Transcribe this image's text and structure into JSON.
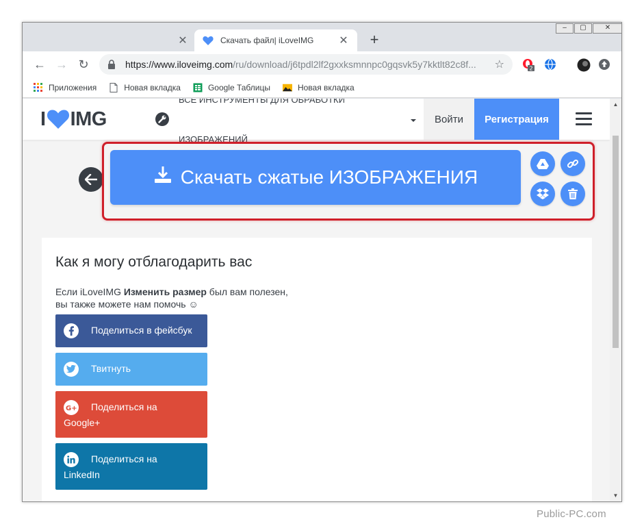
{
  "browser": {
    "tabs": [
      {
        "title": "",
        "active": false
      },
      {
        "title": "Скачать файл| iLoveIMG",
        "active": true
      }
    ],
    "url_host": "https://www.iloveimg.com",
    "url_path": "/ru/download/j6tpdl2lf2gxxksmnnpc0gqsvk5y7kktlt82c8f...",
    "extension_badge": "2",
    "bookmarks": [
      {
        "label": "Приложения",
        "icon": "apps-grid-icon"
      },
      {
        "label": "Новая вкладка",
        "icon": "page-icon"
      },
      {
        "label": "Google Таблицы",
        "icon": "sheets-icon"
      },
      {
        "label": "Новая вкладка",
        "icon": "image-icon"
      }
    ]
  },
  "site": {
    "logo_left": "I",
    "logo_right": "IMG",
    "tools_menu_line1": "ВСЕ ИНСТРУМЕНТЫ ДЛЯ ОБРАБОТКИ",
    "tools_menu_line2": "ИЗОБРАЖЕНИЙ",
    "login": "Войти",
    "signup": "Регистрация",
    "download_label": "Скачать сжатые ИЗОБРАЖЕНИЯ",
    "thanks_title": "Как я могу отблагодарить вас",
    "thanks_text_1": "Если iLoveIMG ",
    "thanks_text_bold": "Изменить размер",
    "thanks_text_2": " был вам полезен,",
    "thanks_text_3": "вы также можете нам помочь ☺",
    "share": [
      {
        "label": "Поделиться в фейсбук",
        "label2": "",
        "color": "#3b5998",
        "icon": "facebook-icon"
      },
      {
        "label": "Твитнуть",
        "label2": "",
        "color": "#55acee",
        "icon": "twitter-icon"
      },
      {
        "label": "Поделиться на",
        "label2": "Google+",
        "color": "#dd4b39",
        "icon": "google-plus-icon"
      },
      {
        "label": "Поделиться на",
        "label2": "LinkedIn",
        "color": "#0e76a8",
        "icon": "linkedin-icon"
      }
    ]
  },
  "colors": {
    "brand_blue": "#4d8ff8",
    "highlight_red": "#cf1f2a",
    "text_dark": "#383e45"
  },
  "watermark": "Public-PC.com"
}
